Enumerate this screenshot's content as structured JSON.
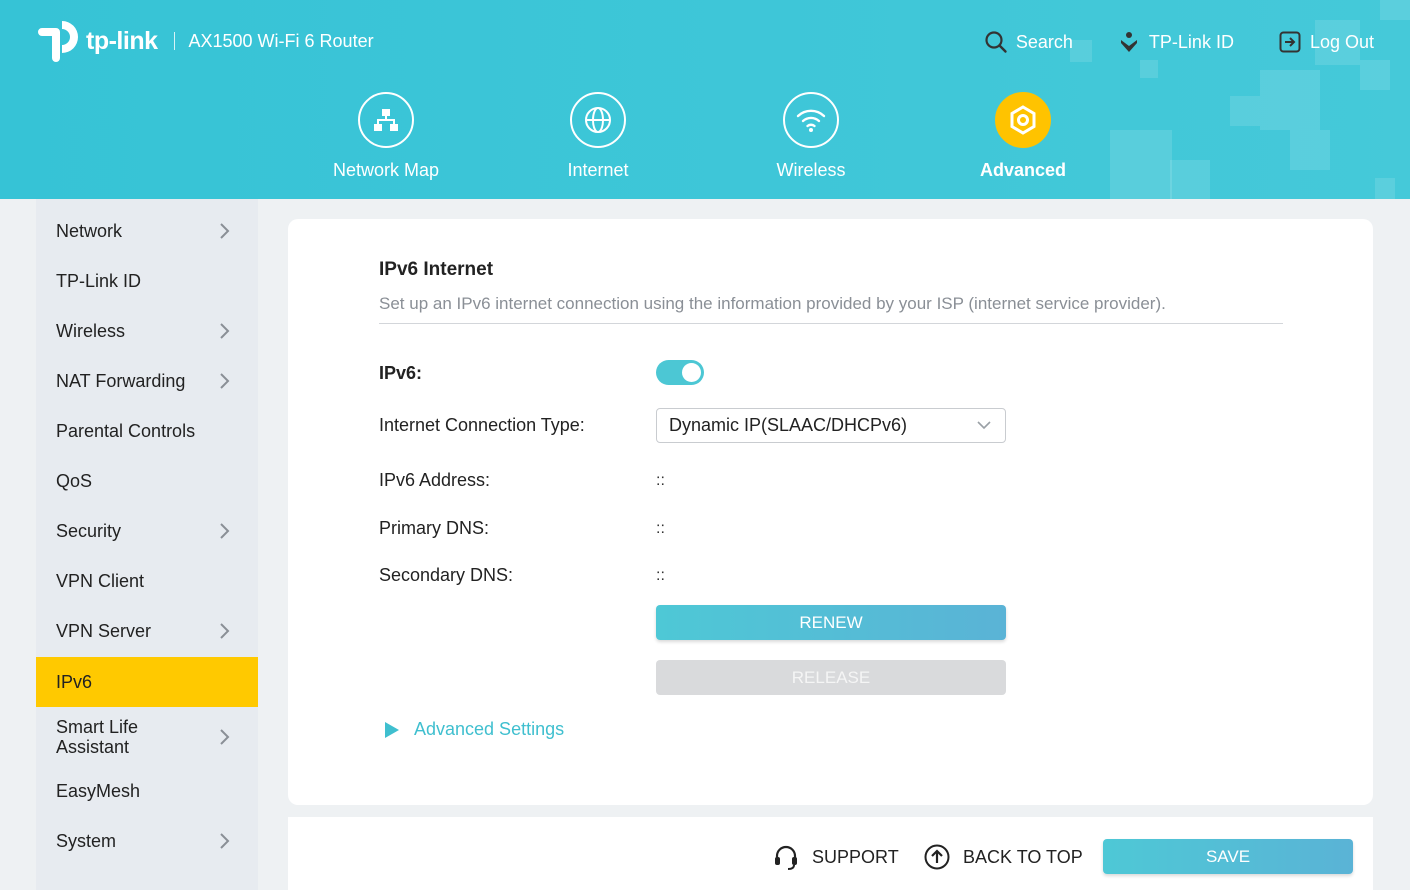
{
  "header": {
    "brand": "tp-link",
    "model": "AX1500 Wi-Fi 6 Router",
    "actions": [
      {
        "label": "Search",
        "icon": "search-icon"
      },
      {
        "label": "TP-Link ID",
        "icon": "user-icon"
      },
      {
        "label": "Log Out",
        "icon": "logout-icon"
      }
    ],
    "nav": [
      {
        "label": "Network Map",
        "icon": "network-map-icon",
        "active": false
      },
      {
        "label": "Internet",
        "icon": "globe-icon",
        "active": false
      },
      {
        "label": "Wireless",
        "icon": "wifi-icon",
        "active": false
      },
      {
        "label": "Advanced",
        "icon": "gear-icon",
        "active": true
      }
    ]
  },
  "sidebar": {
    "items": [
      {
        "label": "Network",
        "expandable": true
      },
      {
        "label": "TP-Link ID",
        "expandable": false
      },
      {
        "label": "Wireless",
        "expandable": true
      },
      {
        "label": "NAT Forwarding",
        "expandable": true
      },
      {
        "label": "Parental Controls",
        "expandable": false
      },
      {
        "label": "QoS",
        "expandable": false
      },
      {
        "label": "Security",
        "expandable": true
      },
      {
        "label": "VPN Client",
        "expandable": false
      },
      {
        "label": "VPN Server",
        "expandable": true
      },
      {
        "label": "IPv6",
        "expandable": false,
        "active": true
      },
      {
        "label": "Smart Life Assistant",
        "expandable": true
      },
      {
        "label": "EasyMesh",
        "expandable": false
      },
      {
        "label": "System",
        "expandable": true
      }
    ]
  },
  "main": {
    "title": "IPv6 Internet",
    "description": "Set up an IPv6 internet connection using the information provided by your ISP (internet service provider).",
    "ipv6_label": "IPv6:",
    "ipv6_enabled": true,
    "connection_type_label": "Internet Connection Type:",
    "connection_type_value": "Dynamic IP(SLAAC/DHCPv6)",
    "ipv6_address_label": "IPv6 Address:",
    "ipv6_address_value": "::",
    "primary_dns_label": "Primary DNS:",
    "primary_dns_value": "::",
    "secondary_dns_label": "Secondary DNS:",
    "secondary_dns_value": "::",
    "renew_label": "RENEW",
    "release_label": "RELEASE",
    "advanced_settings_label": "Advanced Settings"
  },
  "footer": {
    "support_label": "SUPPORT",
    "back_to_top_label": "BACK TO TOP",
    "save_label": "SAVE"
  },
  "colors": {
    "header_bg": "#3fc6d8",
    "accent": "#4cc7d4",
    "active_highlight": "#ffc900",
    "sidebar_bg": "#e7ebf0"
  }
}
